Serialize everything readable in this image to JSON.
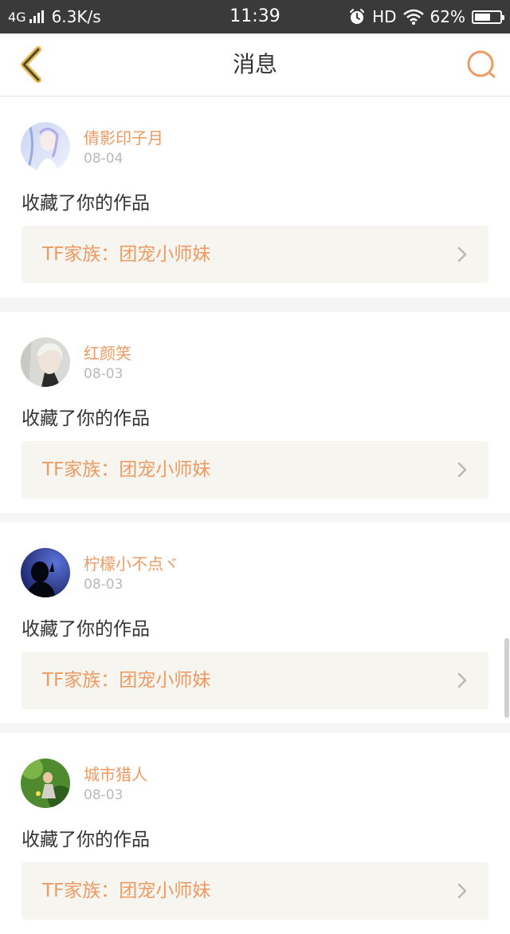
{
  "status_bar": {
    "network": "4G",
    "speed": "6.3K/s",
    "time": "11:39",
    "hd": "HD",
    "battery": "62%",
    "battery_level": 0.62
  },
  "nav": {
    "title": "消息",
    "accent_color": "#ee9a62"
  },
  "messages": [
    {
      "user": "倩影印子月",
      "date": "08-04",
      "action": "收藏了你的作品",
      "work": "TF家族：团宠小师妹",
      "avatar_icon": "avatar-girl-illustration"
    },
    {
      "user": "红颜笑",
      "date": "08-03",
      "action": "收藏了你的作品",
      "work": "TF家族：团宠小师妹",
      "avatar_icon": "avatar-silver-hair"
    },
    {
      "user": "柠檬小不点ヾ",
      "date": "08-03",
      "action": "收藏了你的作品",
      "work": "TF家族：团宠小师妹",
      "avatar_icon": "avatar-silhouette-night"
    },
    {
      "user": "城市猎人",
      "date": "08-03",
      "action": "收藏了你的作品",
      "work": "TF家族：团宠小师妹",
      "avatar_icon": "avatar-green-scene"
    }
  ]
}
